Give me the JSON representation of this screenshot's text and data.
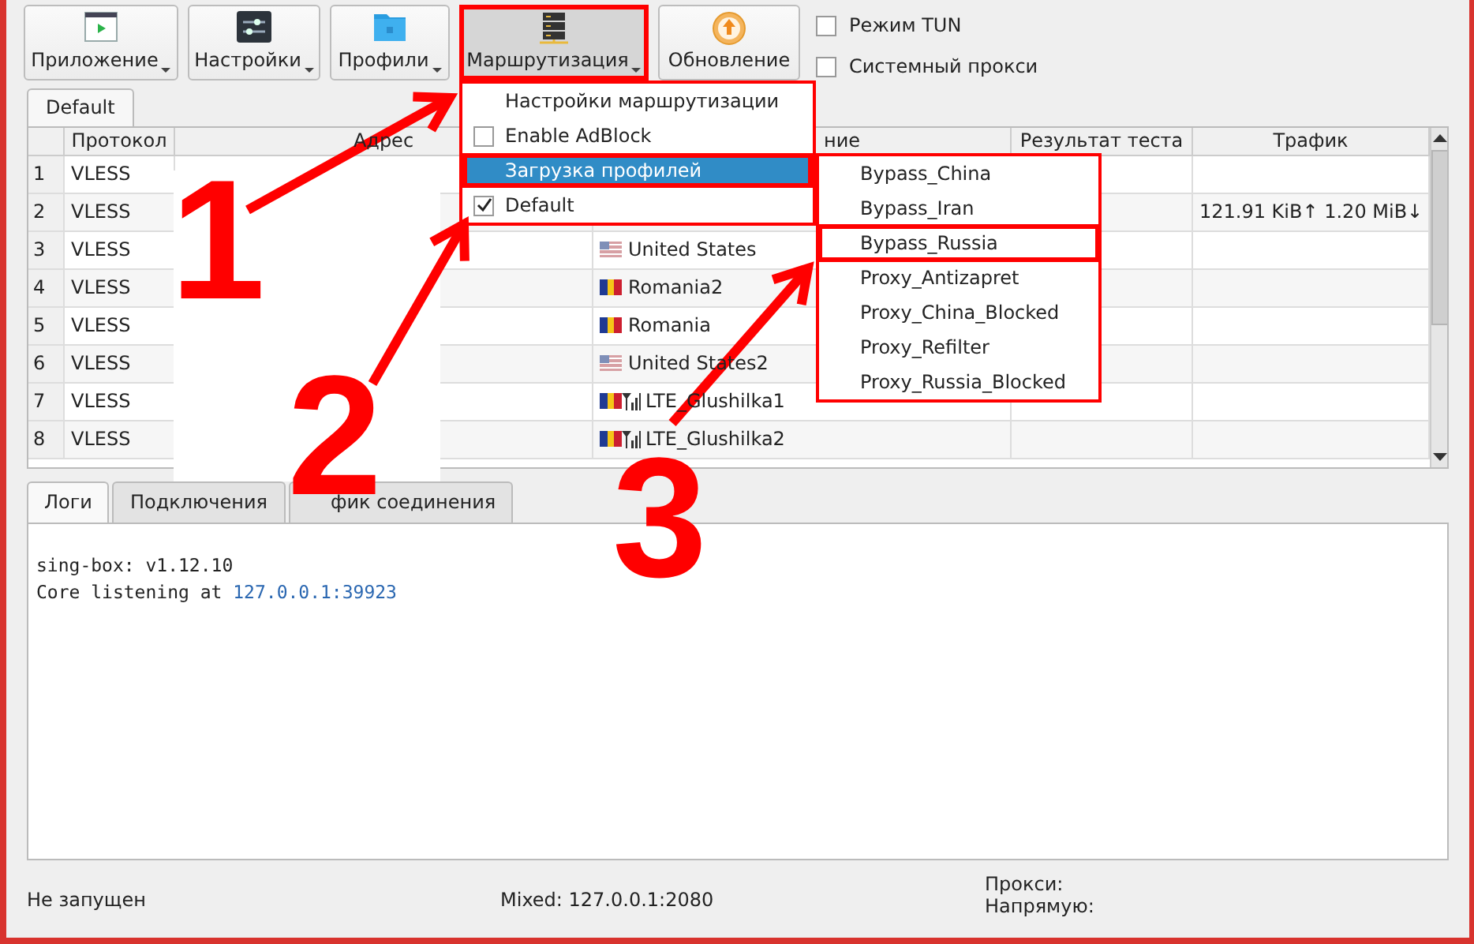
{
  "toolbar": {
    "buttons": [
      {
        "label": "Приложение",
        "menu": true,
        "pressed": false,
        "kind": "app"
      },
      {
        "label": "Настройки",
        "menu": true,
        "pressed": false,
        "kind": "settings"
      },
      {
        "label": "Профили",
        "menu": true,
        "pressed": false,
        "kind": "folder"
      },
      {
        "label": "Маршрутизация",
        "menu": true,
        "pressed": true,
        "kind": "servers"
      },
      {
        "label": "Обновление",
        "menu": false,
        "pressed": false,
        "kind": "update"
      }
    ],
    "checkboxes": [
      {
        "label": "Режим TUN",
        "checked": false
      },
      {
        "label": "Системный прокси",
        "checked": false
      }
    ]
  },
  "group_tabs": [
    {
      "label": "Default",
      "selected": true
    }
  ],
  "table": {
    "columns": [
      "Протокол",
      "Адрес",
      "ние",
      "Результат теста",
      "Трафик"
    ],
    "rows": [
      {
        "number": "1",
        "protocol": "VLESS"
      },
      {
        "number": "2",
        "protocol": "VLESS",
        "traffic": "121.91 KiB↑ 1.20 MiB↓"
      },
      {
        "number": "3",
        "protocol": "VLESS",
        "name": "United States",
        "kind": "us"
      },
      {
        "number": "4",
        "protocol": "VLESS",
        "name": "Romania2",
        "kind": "ro"
      },
      {
        "number": "5",
        "protocol": "VLESS",
        "name": "Romania",
        "kind": "ro"
      },
      {
        "number": "6",
        "protocol": "VLESS",
        "name": "United States2",
        "kind": "us"
      },
      {
        "number": "7",
        "protocol": "VLESS",
        "name": "LTE_Glushilka1",
        "kind": "lte"
      },
      {
        "number": "8",
        "protocol": "VLESS",
        "name": "LTE_Glushilka2",
        "kind": "lte"
      }
    ]
  },
  "routing_menu": {
    "items": [
      {
        "kind": "action",
        "label": "Настройки маршрутизации"
      },
      {
        "kind": "checkbox",
        "label": "Enable AdBlock",
        "checked": false
      },
      {
        "kind": "submenu",
        "label": "Загрузка профилей",
        "selected": true
      },
      {
        "kind": "checkbox",
        "label": "Default",
        "checked": true
      }
    ]
  },
  "profiles_submenu": {
    "items": [
      "Bypass_China",
      "Bypass_Iran",
      "Bypass_Russia",
      "Proxy_Antizapret",
      "Proxy_China_Blocked",
      "Proxy_Refilter",
      "Proxy_Russia_Blocked"
    ]
  },
  "log_tabs": [
    {
      "label": "Логи",
      "selected": true
    },
    {
      "label": "Подключения",
      "selected": false
    },
    {
      "label": "фик соединения",
      "selected": false
    }
  ],
  "log": {
    "lines": [
      {
        "text": "sing-box: v1.12.10"
      },
      {
        "text": "Core listening at ",
        "link": "127.0.0.1:39923"
      }
    ]
  },
  "status_bar": {
    "state": "Не запущен",
    "mixed": "Mixed: 127.0.0.1:2080",
    "proxy": "Прокси:",
    "direct": "Напрямую:"
  },
  "annotations": {
    "steps": [
      "1",
      "2",
      "3"
    ]
  }
}
